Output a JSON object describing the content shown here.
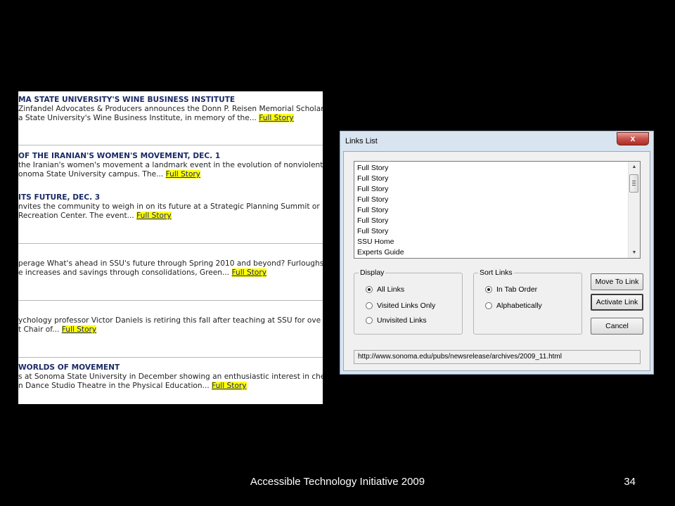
{
  "news": {
    "items": [
      {
        "headline": "MA STATE UNIVERSITY'S WINE BUSINESS INSTITUTE",
        "lines": [
          "Zinfandel Advocates & Producers announces the Donn P. Reisen Memorial Scholar",
          "a State University's Wine Business Institute, in memory of the..."
        ],
        "link": "Full Story"
      },
      {
        "headline": "OF THE IRANIAN'S WOMEN'S MOVEMENT, DEC. 1",
        "lines": [
          "the Iranian's women's movement a landmark event in the evolution of nonviolent",
          "onoma State University campus. The..."
        ],
        "link": "Full Story"
      },
      {
        "headline": "ITS FUTURE, DEC. 3",
        "lines": [
          "nvites the community to weigh in on its future at a Strategic Planning Summit or",
          "Recreation Center. The event..."
        ],
        "link": "Full Story"
      },
      {
        "headline": "",
        "lines": [
          "perage What's ahead in SSU's future through Spring 2010 and beyond? Furloughs",
          "e increases and savings through consolidations, Green..."
        ],
        "link": "Full Story"
      },
      {
        "headline": "",
        "lines": [
          "ychology professor Victor Daniels is retiring this fall after teaching at SSU for ove",
          "t Chair of..."
        ],
        "link": "Full Story"
      },
      {
        "headline": "WORLDS OF MOVEMENT",
        "lines": [
          "s at Sonoma State University in December showing an enthusiastic interest in che",
          "n Dance Studio Theatre in the Physical Education..."
        ],
        "link": "Full Story"
      }
    ]
  },
  "dialog": {
    "title": "Links List",
    "close_glyph": "x",
    "links": [
      "Full Story",
      "Full Story",
      "Full Story",
      "Full Story",
      "Full Story",
      "Full Story",
      "Full Story",
      "SSU Home",
      "Experts Guide"
    ],
    "display": {
      "legend": "Display",
      "options": [
        {
          "label": "All Links",
          "selected": true
        },
        {
          "label": "Visited Links Only",
          "selected": false
        },
        {
          "label": "Unvisited Links",
          "selected": false
        }
      ]
    },
    "sort": {
      "legend": "Sort Links",
      "options": [
        {
          "label": "In Tab Order",
          "selected": true
        },
        {
          "label": "Alphabetically",
          "selected": false
        }
      ]
    },
    "buttons": {
      "move": "Move To Link",
      "activate": "Activate Link",
      "cancel": "Cancel"
    },
    "url": "http://www.sonoma.edu/pubs/newsrelease/archives/2009_11.html",
    "scroll_up_glyph": "▲",
    "scroll_down_glyph": "▼"
  },
  "footer": {
    "title": "Accessible Technology Initiative 2009",
    "slide_number": "34"
  }
}
